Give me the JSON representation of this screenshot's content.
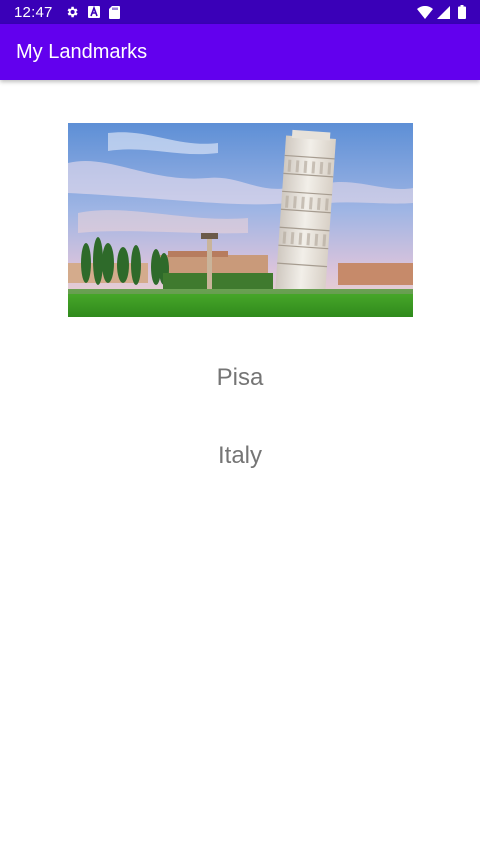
{
  "status_bar": {
    "time": "12:47",
    "left_icons": [
      "gear-icon",
      "font-a-icon",
      "sd-card-icon"
    ],
    "right_icons": [
      "wifi-icon",
      "cell-signal-icon",
      "battery-icon"
    ]
  },
  "app_bar": {
    "title": "My Landmarks",
    "color": "#6200ee",
    "status_color": "#3a00b8"
  },
  "landmark": {
    "image_icon": "leaning-tower-photo",
    "name": "Pisa",
    "country": "Italy",
    "text_color": "#757575"
  }
}
